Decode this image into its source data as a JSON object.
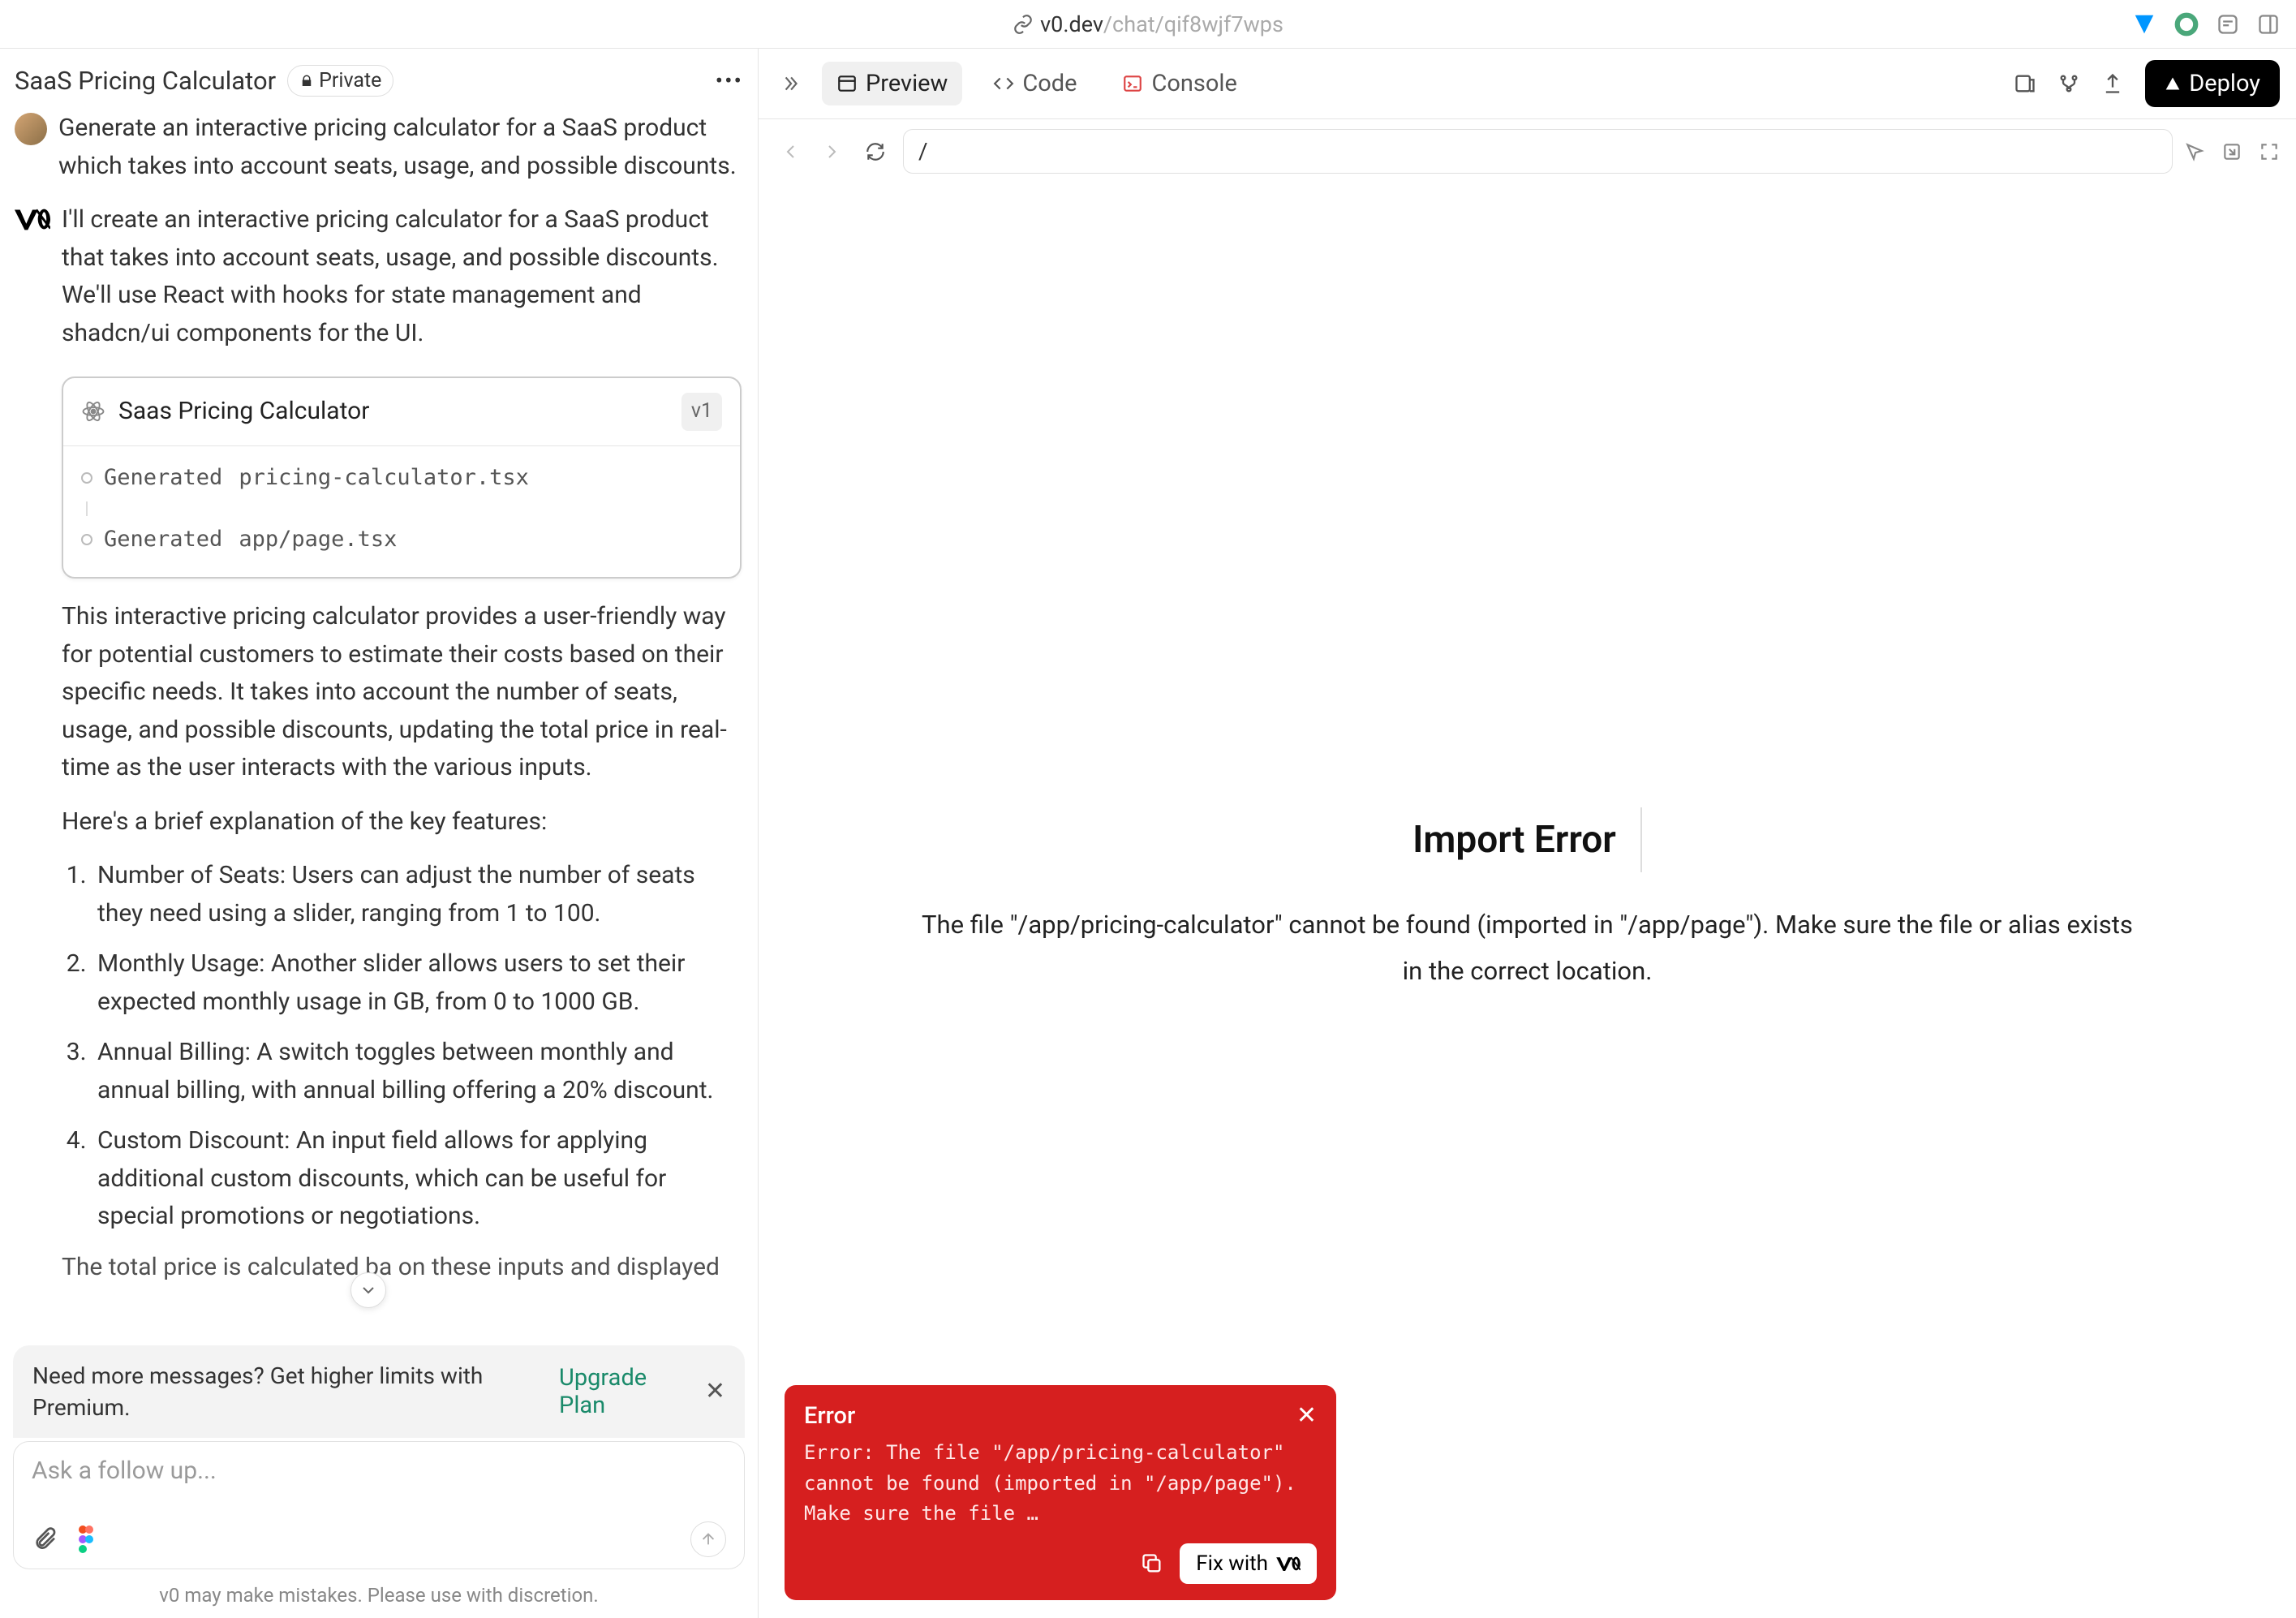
{
  "url": {
    "prefix": "v0.dev",
    "suffix": "/chat/qif8wjf7wps"
  },
  "chat": {
    "title": "SaaS Pricing Calculator",
    "private_label": "Private",
    "user_message": "Generate an interactive pricing calculator for a SaaS product which takes into account seats, usage, and possible discounts.",
    "assistant_intro": "I'll create an interactive pricing calculator for a SaaS product that takes into account seats, usage, and possible discounts. We'll use React with hooks for state management and shadcn/ui components for the UI.",
    "codecard": {
      "title": "Saas Pricing Calculator",
      "version": "v1",
      "files": [
        {
          "label": "Generated",
          "name": "pricing-calculator.tsx"
        },
        {
          "label": "Generated",
          "name": "app/page.tsx"
        }
      ]
    },
    "para1": "This interactive pricing calculator provides a user-friendly way for potential customers to estimate their costs based on their specific needs. It takes into account the number of seats, usage, and possible discounts, updating the total price in real-time as the user interacts with the various inputs.",
    "para2": "Here's a brief explanation of the key features:",
    "features": [
      "Number of Seats: Users can adjust the number of seats they need using a slider, ranging from 1 to 100.",
      "Monthly Usage: Another slider allows users to set their expected monthly usage in GB, from 0 to 1000 GB.",
      "Annual Billing: A switch toggles between monthly and annual billing, with annual billing offering a 20% discount.",
      "Custom Discount: An input field allows for applying additional custom discounts, which can be useful for special promotions or negotiations."
    ],
    "cutoff": "The total price is calculated ba       on these inputs and displayed"
  },
  "upsell": {
    "text": "Need more messages? Get higher limits with Premium.",
    "cta": "Upgrade Plan"
  },
  "input": {
    "placeholder": "Ask a follow up..."
  },
  "disclaimer": "v0 may make mistakes. Please use with discretion.",
  "tabs": {
    "preview": "Preview",
    "code": "Code",
    "console": "Console",
    "deploy": "Deploy"
  },
  "nav": {
    "path": "/"
  },
  "import_error": {
    "title": "Import Error",
    "message": "The file \"/app/pricing-calculator\" cannot be found (imported in \"/app/page\"). Make sure the file or alias exists in the correct location."
  },
  "toast": {
    "title": "Error",
    "body": "Error: The file \"/app/pricing-calculator\" cannot be found (imported in \"/app/page\"). Make sure the file …",
    "fix": "Fix with"
  }
}
